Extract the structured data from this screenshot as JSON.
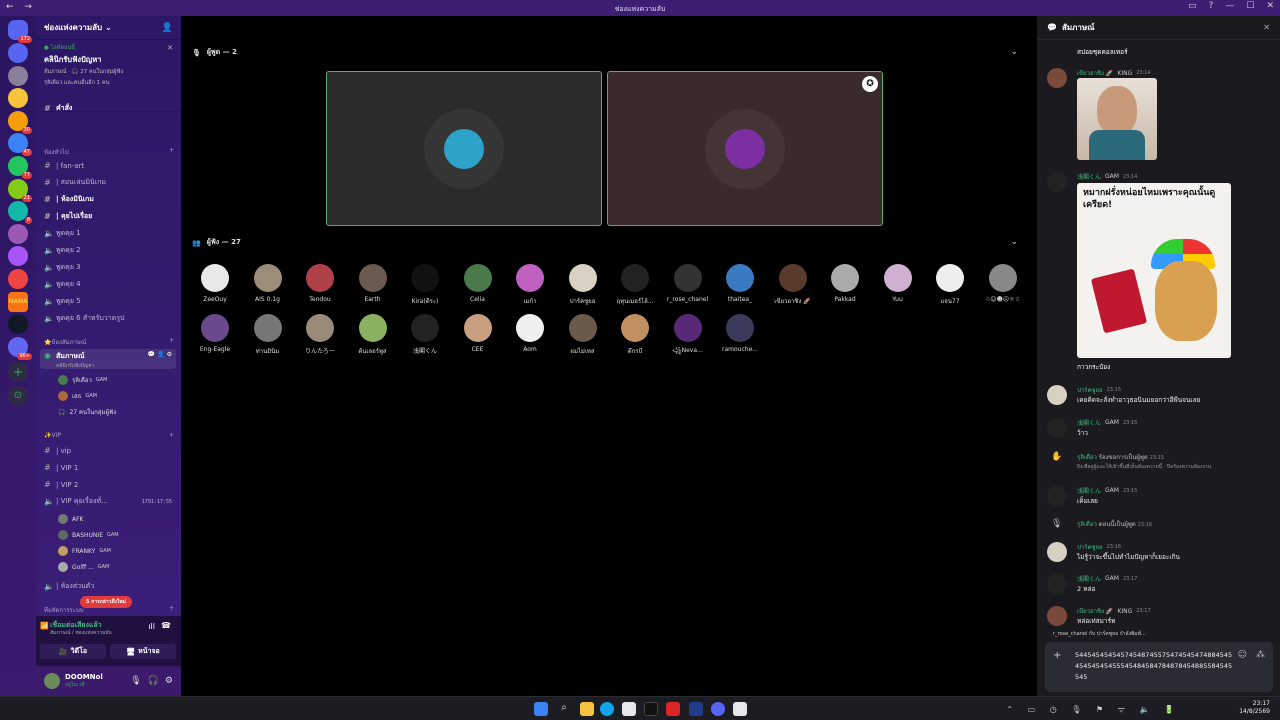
{
  "window": {
    "title": "ช่องแห่งความลับ",
    "nav": "← →"
  },
  "server_list": {
    "badges": [
      "172",
      "",
      "",
      "",
      "30",
      "47",
      "77",
      "21",
      "8",
      "",
      "",
      "",
      "",
      "",
      "96+"
    ],
    "colors": [
      "#5865f2",
      "#8a7f9a",
      "#f7c43b",
      "#f59e0b",
      "#3b82f6",
      "#22c55e",
      "#84cc16",
      "#14b8a6",
      "#9b59b6",
      "#a855f7",
      "#ef4444",
      "#f97316",
      "#111827",
      "#6366f1"
    ],
    "logo_text": "NANA"
  },
  "guild": {
    "name": "ช่องแห่งความลับ",
    "chevron": "⌄"
  },
  "event": {
    "live": "● ไลฟ์ตอนนี้",
    "title": "คลินิกรับฟังปัญหา",
    "line1": "สัมภาษณ์ · 🎧 27 คนในกลุ่มผู้ฟัง",
    "line2": "รุลิเดือว และคนอื่นอีก 1 คน"
  },
  "channels": {
    "commands": "คำสั่ง",
    "cat_general": "ห้องทั่วไป",
    "general": [
      "| fan-art",
      "| สอนเล่นมินิเกม",
      "| ห้องมินิเกม",
      "| คุยไปเรื่อย"
    ],
    "voice": [
      "พูดคุย 1",
      "พูดคุย 2",
      "พูดคุย 3",
      "พูดคุย 4",
      "พูดคุย 5",
      "พูดคุย 6 สำหรับวาดรูป"
    ],
    "cat_interview": "⭐ห้องสัมภาษณ์",
    "stage": {
      "name": "สัมภาษณ์",
      "sub": "คลินิกรับฟังปัญหา"
    },
    "stage_members": [
      {
        "name": "รุลิเดือว",
        "tag": "GAM"
      },
      {
        "name": "เสธ",
        "tag": "GAM"
      }
    ],
    "audience_count": "27 คนในกลุ่มผู้ฟัง",
    "cat_vip": "✨VIP",
    "vip": [
      "| vip",
      "| VIP 1",
      "| VIP 2",
      "| VIP คุยเรื่องทั่..."
    ],
    "vip_timer": "1791:17:55",
    "vip_members": [
      {
        "name": "AFK",
        "tag": ""
      },
      {
        "name": "BASHUNIE",
        "tag": "GAM"
      },
      {
        "name": "FRANKY",
        "tag": "GAM"
      },
      {
        "name": "Golff ...",
        "tag": "GAM"
      }
    ],
    "private": "| ห้องส่วนตัว",
    "cat_bottom": "ทีมจัดการระบบ",
    "unread_pill": "5 การกล่าวถึงใหม่"
  },
  "voice_status": {
    "connected": "เชื่อมต่อเสียงแล้ว",
    "where": "สัมภาษณ์ / ช่องแห่งความลับ",
    "video": "วิดีโอ",
    "screen": "หน้าจอ"
  },
  "user": {
    "name": "DOOMNol",
    "status": "อยู่ในเวที"
  },
  "stage_area": {
    "speakers_label": "ผู้พูด — 2",
    "audience_label": "ผู้ฟัง — 27",
    "speaker_colors": [
      "#2ea3c9",
      "#7b2fa0"
    ],
    "audience": [
      {
        "name": "ZeeOuy",
        "color": "#e8e8e8"
      },
      {
        "name": "AIS 0.1g",
        "color": "#9a8e7a"
      },
      {
        "name": "Tendou",
        "color": "#b0404a"
      },
      {
        "name": "Earth",
        "color": "#6a5a50"
      },
      {
        "name": "Kira(ดีระ)",
        "color": "#111111"
      },
      {
        "name": "Celia",
        "color": "#4a7a4a"
      },
      {
        "name": "เมก้า",
        "color": "#c060c0"
      },
      {
        "name": "ปาร์คซูยอ",
        "color": "#d8d0c0"
      },
      {
        "name": "ฤทุนเมอร์ไล้...",
        "color": "#222222"
      },
      {
        "name": "r_rose_chanel",
        "color": "#333333"
      },
      {
        "name": "thaitea_",
        "color": "#3a7ac0"
      },
      {
        "name": "เขียวอาชิง 🚀",
        "color": "#5a3a2a"
      },
      {
        "name": "Pakkad",
        "color": "#aaaaaa"
      },
      {
        "name": "Yuu",
        "color": "#d0b0d0"
      },
      {
        "name": "แจน77",
        "color": "#eeeeee"
      },
      {
        "name": "☃☺☻☹☼☃",
        "color": "#888888"
      },
      {
        "name": "Eng-Eagle",
        "color": "#6a4a8a"
      },
      {
        "name": "ท่านมินิม",
        "color": "#777777"
      },
      {
        "name": "りんたろー",
        "color": "#9a8a7a"
      },
      {
        "name": "ต้นเลอร์พูส",
        "color": "#8ab060"
      },
      {
        "name": "浅閣くん",
        "color": "#222222"
      },
      {
        "name": "CEE",
        "color": "#c8a080"
      },
      {
        "name": "Aom",
        "color": "#f0f0f0"
      },
      {
        "name": "ผมไม่เทส",
        "color": "#6a5a4a"
      },
      {
        "name": "ตึกรบี",
        "color": "#c09060"
      },
      {
        "name": "꧁Neva...",
        "color": "#5a2a7a"
      },
      {
        "name": "ramouche...",
        "color": "#3a3a5a"
      }
    ]
  },
  "chat": {
    "title": "สัมภาษณ์",
    "top_text": "สปอยชุดคอลเทอร์",
    "messages": [
      {
        "user": "เขียวอาชิง 🚀",
        "role": "KING",
        "time": "23:14",
        "text": "",
        "avatar": "#7a4a3a",
        "image": "meme-man"
      },
      {
        "user": "浅閣くん",
        "role": "GAM",
        "time": "23:14",
        "text": "กาวกระป๋อง",
        "avatar": "#222",
        "image": "doge"
      },
      {
        "user": "ปาร์คซูยอ",
        "role": "",
        "time": "23:15",
        "text": "เคยคิดจะลั่งทำอาวุธอนินมยอกว่าอีพีนจนเลย",
        "avatar": "#d8d0c0"
      },
      {
        "user": "浅閣くん",
        "role": "GAM",
        "time": "23:15",
        "text": "ว้าว",
        "avatar": "#222"
      },
      {
        "user": "浅閣くん",
        "role": "GAM",
        "time": "23:15",
        "text": "เค็มเลย",
        "avatar": "#222"
      },
      {
        "user": "ปาร์คซูยอ",
        "role": "",
        "time": "23:16",
        "text": "ไม่รู้ว่าจะขึ้นไปทำไมปัญหาก็เยอะเกิน",
        "avatar": "#d8d0c0"
      },
      {
        "user": "浅閣くん",
        "role": "GAM",
        "time": "23:17",
        "text": "2 หล่อ",
        "avatar": "#222"
      },
      {
        "user": "เขียวอาชิง 🚀",
        "role": "KING",
        "time": "23:17",
        "text": "หล่อเท่สมาร์ท",
        "avatar": "#7a4a3a"
      }
    ],
    "meme_text": "หมากฝรั่งหน่อยไหมเพราะคุณนั้นดูเครียด!",
    "sys1": {
      "user": "รุลิเดือว",
      "text": "ร้องขอการเป็นผู้พูด",
      "time": "23:15",
      "sub": "ยิงเพื่อดูผู้และให้เข้าขึ้นที่เห็นห้องความนี้ · ปิดร้องความห้องงาน"
    },
    "sys2": {
      "user": "รุลิเดือว",
      "text": "ตอนนี้เป็นผู้พูด",
      "time": "23:16"
    },
    "typing": "r_rose_chanel กับ ปาร์คซูยอ กำลังพิมพ์...",
    "composer_value": "5445454545457454874557547454547488454545454545455545484584784878454885584545545"
  },
  "taskbar": {
    "time": "23:17",
    "date": "14/8/2569"
  }
}
